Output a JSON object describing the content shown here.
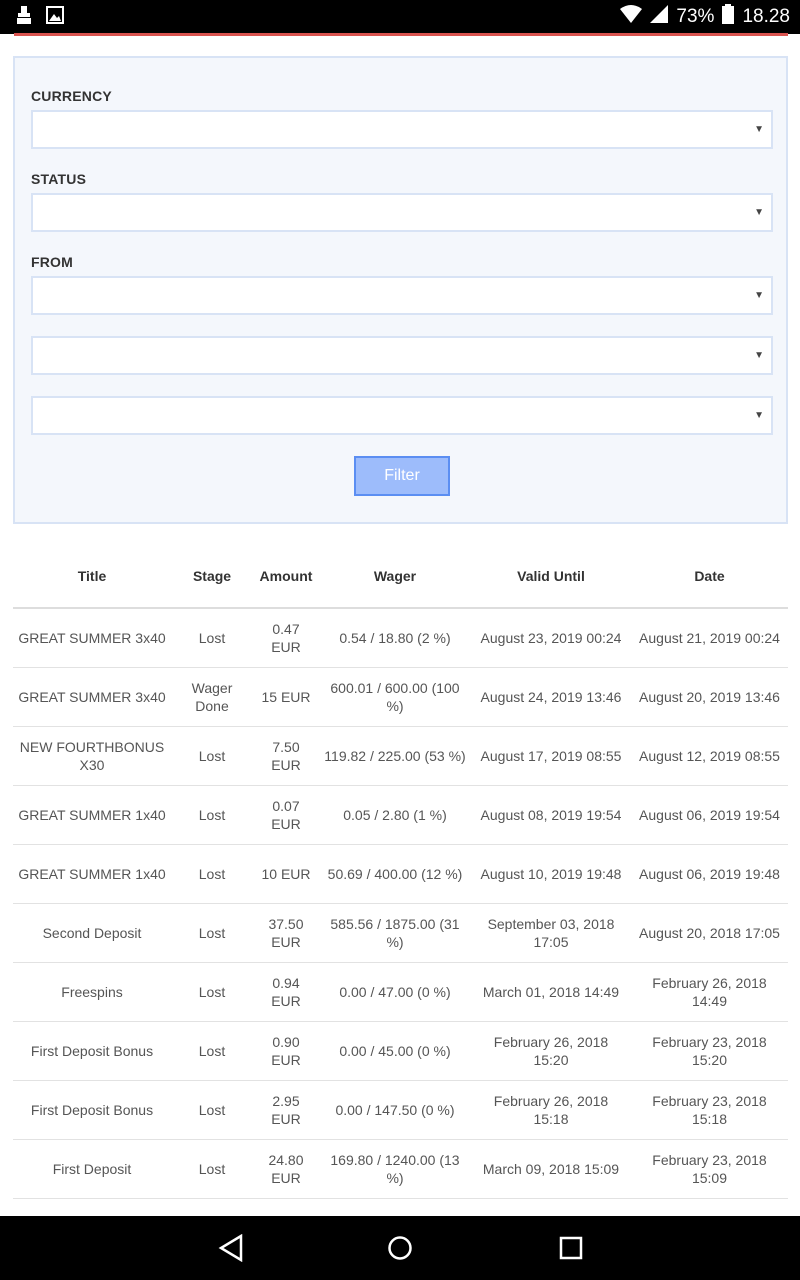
{
  "status_bar": {
    "battery": "73%",
    "time": "18.28"
  },
  "filter": {
    "currency_label": "CURRENCY",
    "status_label": "STATUS",
    "from_label": "FROM",
    "caret": "▼",
    "filter_button": "Filter"
  },
  "table": {
    "headers": [
      "Title",
      "Stage",
      "Amount",
      "Wager",
      "Valid Until",
      "Date"
    ],
    "rows": [
      [
        "GREAT SUMMER 3x40",
        "Lost",
        "0.47 EUR",
        "0.54 / 18.80 (2 %)",
        "August 23, 2019 00:24",
        "August 21, 2019 00:24"
      ],
      [
        "GREAT SUMMER 3x40",
        "Wager Done",
        "15 EUR",
        "600.01 / 600.00 (100 %)",
        "August 24, 2019 13:46",
        "August 20, 2019 13:46"
      ],
      [
        "NEW FOURTHBONUS X30",
        "Lost",
        "7.50 EUR",
        "119.82 / 225.00 (53 %)",
        "August 17, 2019 08:55",
        "August 12, 2019 08:55"
      ],
      [
        "GREAT SUMMER 1x40",
        "Lost",
        "0.07 EUR",
        "0.05 / 2.80 (1 %)",
        "August 08, 2019 19:54",
        "August 06, 2019 19:54"
      ],
      [
        "GREAT SUMMER 1x40",
        "Lost",
        "10 EUR",
        "50.69 / 400.00 (12 %)",
        "August 10, 2019 19:48",
        "August 06, 2019 19:48"
      ],
      [
        "Second Deposit",
        "Lost",
        "37.50 EUR",
        "585.56 / 1875.00 (31 %)",
        "September 03, 2018 17:05",
        "August 20, 2018 17:05"
      ],
      [
        "Freespins",
        "Lost",
        "0.94 EUR",
        "0.00 / 47.00 (0 %)",
        "March 01, 2018 14:49",
        "February 26, 2018 14:49"
      ],
      [
        "First Deposit Bonus",
        "Lost",
        "0.90 EUR",
        "0.00 / 45.00 (0 %)",
        "February 26, 2018 15:20",
        "February 23, 2018 15:20"
      ],
      [
        "First Deposit Bonus",
        "Lost",
        "2.95 EUR",
        "0.00 / 147.50 (0 %)",
        "February 26, 2018 15:18",
        "February 23, 2018 15:18"
      ],
      [
        "First Deposit",
        "Lost",
        "24.80 EUR",
        "169.80 / 1240.00 (13 %)",
        "March 09, 2018 15:09",
        "February 23, 2018 15:09"
      ]
    ]
  },
  "colors": {
    "accent_line": "#d9534f",
    "panel_bg": "#f4f7fc",
    "button_bg": "#9dbcfb"
  }
}
